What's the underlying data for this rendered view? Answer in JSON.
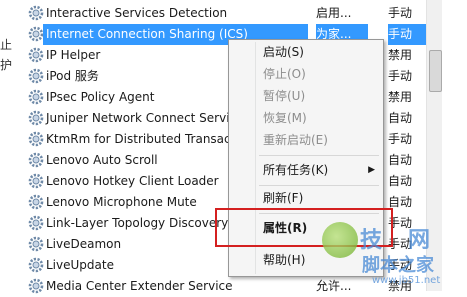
{
  "left_edge": [
    "止",
    "护"
  ],
  "services": [
    {
      "name": "Interactive Services Detection",
      "status": "启用...",
      "start": "手动"
    },
    {
      "name": "Internet Connection Sharing (ICS)",
      "status": "为家...",
      "start": "手动"
    },
    {
      "name": "IP Helper",
      "status": "",
      "start": "禁用"
    },
    {
      "name": "iPod 服务",
      "status": "",
      "start": "手动"
    },
    {
      "name": "IPsec Policy Agent",
      "status": "",
      "start": "禁用"
    },
    {
      "name": "Juniper Network Connect Servic",
      "status": "",
      "start": "自动"
    },
    {
      "name": "KtmRm for Distributed Transact",
      "status": "",
      "start": "手动"
    },
    {
      "name": "Lenovo Auto Scroll",
      "status": "",
      "start": "自动"
    },
    {
      "name": "Lenovo Hotkey Client Loader",
      "status": "",
      "start": "自动"
    },
    {
      "name": "Lenovo Microphone Mute",
      "status": "",
      "start": "自动"
    },
    {
      "name": "Link-Layer Topology Discovery",
      "status": "",
      "start": "手动"
    },
    {
      "name": "LiveDeamon",
      "status": "",
      "start": "手动"
    },
    {
      "name": "LiveUpdate",
      "status": "",
      "start": "手动"
    },
    {
      "name": "Media Center Extender Service",
      "status": "允许...",
      "start": "禁用"
    }
  ],
  "context_menu": {
    "start": "启动(S)",
    "stop": "停止(O)",
    "pause": "暂停(U)",
    "resume": "恢复(M)",
    "restart": "重新启动(E)",
    "all_tasks": "所有任务(K)",
    "refresh": "刷新(F)",
    "properties": "属性(R)",
    "help": "帮助(H)"
  },
  "watermark": {
    "big": "技",
    "big2": "网",
    "small": "脚本之家",
    "url": "www.jb51.net"
  }
}
